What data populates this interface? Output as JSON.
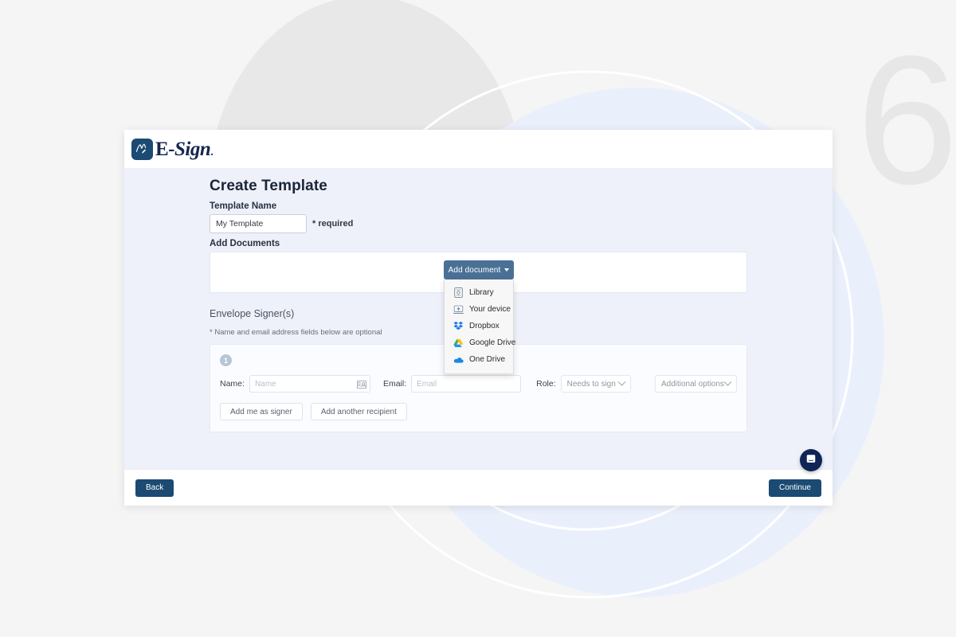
{
  "brand": {
    "logo_text_primary": "E-",
    "logo_text_secondary": "Sign",
    "logo_dot": ".",
    "logo_badge_icon": "signature-icon",
    "accent_dark": "#1b4a73",
    "accent_navy": "#16264f",
    "button_steel": "#4a7195"
  },
  "page": {
    "title": "Create Template",
    "template_name_label": "Template Name",
    "template_name_value": "My Template",
    "template_name_placeholder": "My Template",
    "required_note": "* required",
    "add_documents_label": "Add Documents"
  },
  "add_document": {
    "button_label": "Add document",
    "menu_open": true,
    "items": [
      {
        "label": "Library",
        "icon": "library-document-icon"
      },
      {
        "label": "Your device",
        "icon": "laptop-upload-icon"
      },
      {
        "label": "Dropbox",
        "icon": "dropbox-icon"
      },
      {
        "label": "Google Drive",
        "icon": "google-drive-icon"
      },
      {
        "label": "One Drive",
        "icon": "onedrive-cloud-icon"
      }
    ]
  },
  "signers": {
    "heading": "Envelope Signer(s)",
    "optional_note": "* Name and email address fields below are optional",
    "badge_number": "1",
    "name_label": "Name:",
    "name_placeholder": "Name",
    "name_value": "",
    "email_label": "Email:",
    "email_placeholder": "Email",
    "email_value": "",
    "role_label": "Role:",
    "role_value": "Needs to sign",
    "role_options": [
      "Needs to sign"
    ],
    "additional_options_value": "Additional options",
    "add_me_as_signer_label": "Add me as signer",
    "add_another_recipient_label": "Add another recipient"
  },
  "footer": {
    "back_label": "Back",
    "continue_label": "Continue",
    "chat_icon": "chat-bubble-icon"
  },
  "background": {
    "watermark_number": "6"
  }
}
